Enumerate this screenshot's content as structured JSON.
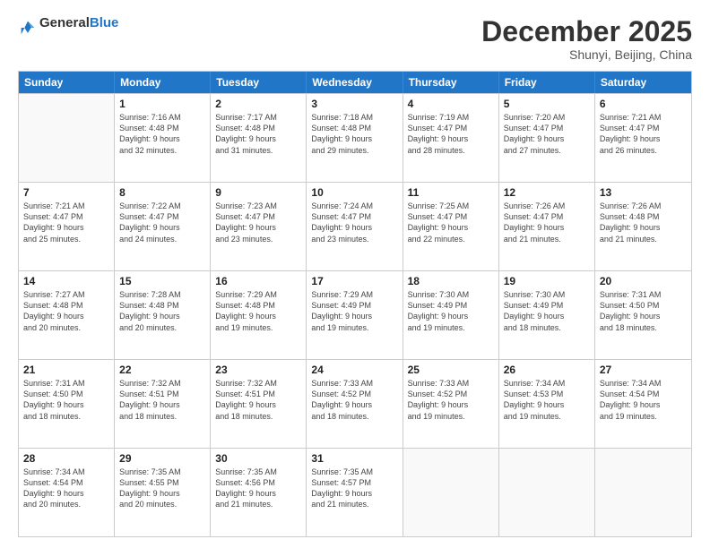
{
  "header": {
    "logo_general": "General",
    "logo_blue": "Blue",
    "month_title": "December 2025",
    "subtitle": "Shunyi, Beijing, China"
  },
  "weekdays": [
    "Sunday",
    "Monday",
    "Tuesday",
    "Wednesday",
    "Thursday",
    "Friday",
    "Saturday"
  ],
  "rows": [
    [
      {
        "day": "",
        "info": ""
      },
      {
        "day": "1",
        "info": "Sunrise: 7:16 AM\nSunset: 4:48 PM\nDaylight: 9 hours\nand 32 minutes."
      },
      {
        "day": "2",
        "info": "Sunrise: 7:17 AM\nSunset: 4:48 PM\nDaylight: 9 hours\nand 31 minutes."
      },
      {
        "day": "3",
        "info": "Sunrise: 7:18 AM\nSunset: 4:48 PM\nDaylight: 9 hours\nand 29 minutes."
      },
      {
        "day": "4",
        "info": "Sunrise: 7:19 AM\nSunset: 4:47 PM\nDaylight: 9 hours\nand 28 minutes."
      },
      {
        "day": "5",
        "info": "Sunrise: 7:20 AM\nSunset: 4:47 PM\nDaylight: 9 hours\nand 27 minutes."
      },
      {
        "day": "6",
        "info": "Sunrise: 7:21 AM\nSunset: 4:47 PM\nDaylight: 9 hours\nand 26 minutes."
      }
    ],
    [
      {
        "day": "7",
        "info": "Sunrise: 7:21 AM\nSunset: 4:47 PM\nDaylight: 9 hours\nand 25 minutes."
      },
      {
        "day": "8",
        "info": "Sunrise: 7:22 AM\nSunset: 4:47 PM\nDaylight: 9 hours\nand 24 minutes."
      },
      {
        "day": "9",
        "info": "Sunrise: 7:23 AM\nSunset: 4:47 PM\nDaylight: 9 hours\nand 23 minutes."
      },
      {
        "day": "10",
        "info": "Sunrise: 7:24 AM\nSunset: 4:47 PM\nDaylight: 9 hours\nand 23 minutes."
      },
      {
        "day": "11",
        "info": "Sunrise: 7:25 AM\nSunset: 4:47 PM\nDaylight: 9 hours\nand 22 minutes."
      },
      {
        "day": "12",
        "info": "Sunrise: 7:26 AM\nSunset: 4:47 PM\nDaylight: 9 hours\nand 21 minutes."
      },
      {
        "day": "13",
        "info": "Sunrise: 7:26 AM\nSunset: 4:48 PM\nDaylight: 9 hours\nand 21 minutes."
      }
    ],
    [
      {
        "day": "14",
        "info": "Sunrise: 7:27 AM\nSunset: 4:48 PM\nDaylight: 9 hours\nand 20 minutes."
      },
      {
        "day": "15",
        "info": "Sunrise: 7:28 AM\nSunset: 4:48 PM\nDaylight: 9 hours\nand 20 minutes."
      },
      {
        "day": "16",
        "info": "Sunrise: 7:29 AM\nSunset: 4:48 PM\nDaylight: 9 hours\nand 19 minutes."
      },
      {
        "day": "17",
        "info": "Sunrise: 7:29 AM\nSunset: 4:49 PM\nDaylight: 9 hours\nand 19 minutes."
      },
      {
        "day": "18",
        "info": "Sunrise: 7:30 AM\nSunset: 4:49 PM\nDaylight: 9 hours\nand 19 minutes."
      },
      {
        "day": "19",
        "info": "Sunrise: 7:30 AM\nSunset: 4:49 PM\nDaylight: 9 hours\nand 18 minutes."
      },
      {
        "day": "20",
        "info": "Sunrise: 7:31 AM\nSunset: 4:50 PM\nDaylight: 9 hours\nand 18 minutes."
      }
    ],
    [
      {
        "day": "21",
        "info": "Sunrise: 7:31 AM\nSunset: 4:50 PM\nDaylight: 9 hours\nand 18 minutes."
      },
      {
        "day": "22",
        "info": "Sunrise: 7:32 AM\nSunset: 4:51 PM\nDaylight: 9 hours\nand 18 minutes."
      },
      {
        "day": "23",
        "info": "Sunrise: 7:32 AM\nSunset: 4:51 PM\nDaylight: 9 hours\nand 18 minutes."
      },
      {
        "day": "24",
        "info": "Sunrise: 7:33 AM\nSunset: 4:52 PM\nDaylight: 9 hours\nand 18 minutes."
      },
      {
        "day": "25",
        "info": "Sunrise: 7:33 AM\nSunset: 4:52 PM\nDaylight: 9 hours\nand 19 minutes."
      },
      {
        "day": "26",
        "info": "Sunrise: 7:34 AM\nSunset: 4:53 PM\nDaylight: 9 hours\nand 19 minutes."
      },
      {
        "day": "27",
        "info": "Sunrise: 7:34 AM\nSunset: 4:54 PM\nDaylight: 9 hours\nand 19 minutes."
      }
    ],
    [
      {
        "day": "28",
        "info": "Sunrise: 7:34 AM\nSunset: 4:54 PM\nDaylight: 9 hours\nand 20 minutes."
      },
      {
        "day": "29",
        "info": "Sunrise: 7:35 AM\nSunset: 4:55 PM\nDaylight: 9 hours\nand 20 minutes."
      },
      {
        "day": "30",
        "info": "Sunrise: 7:35 AM\nSunset: 4:56 PM\nDaylight: 9 hours\nand 21 minutes."
      },
      {
        "day": "31",
        "info": "Sunrise: 7:35 AM\nSunset: 4:57 PM\nDaylight: 9 hours\nand 21 minutes."
      },
      {
        "day": "",
        "info": ""
      },
      {
        "day": "",
        "info": ""
      },
      {
        "day": "",
        "info": ""
      }
    ]
  ]
}
